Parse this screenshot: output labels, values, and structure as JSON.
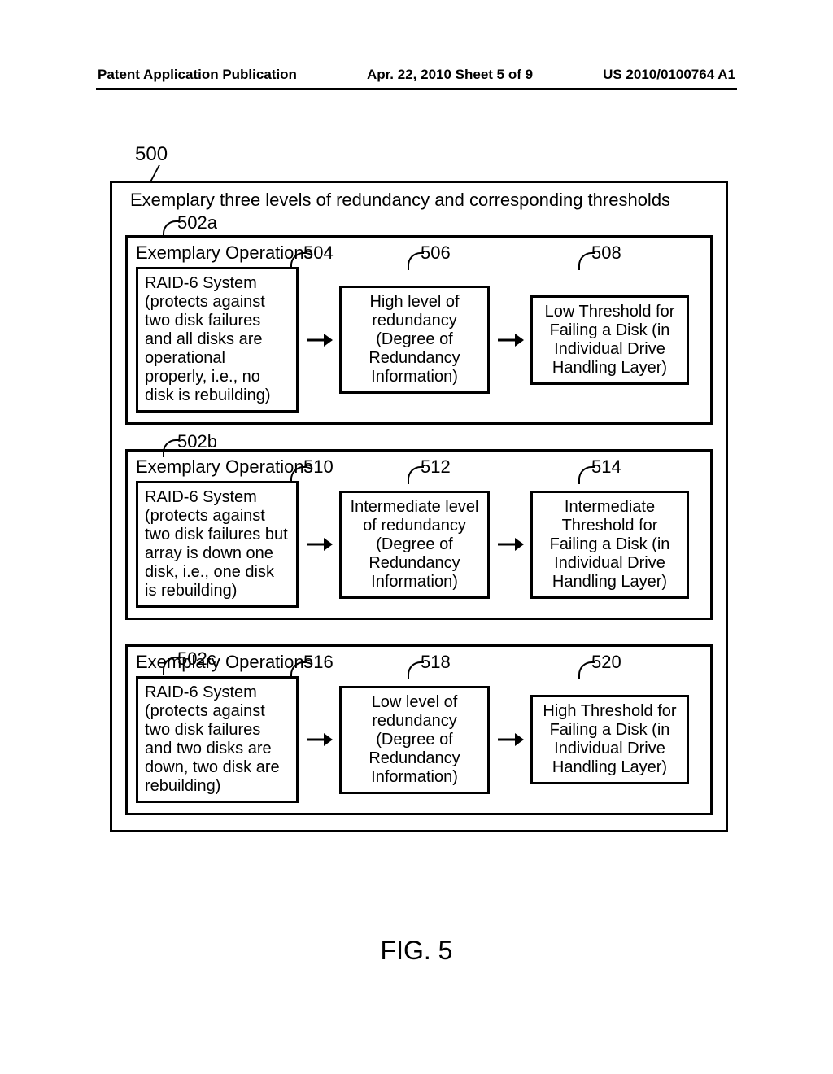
{
  "header": {
    "left": "Patent Application Publication",
    "center": "Apr. 22, 2010  Sheet 5 of 9",
    "right": "US 2010/0100764 A1"
  },
  "ref500": "500",
  "outerTitle": "Exemplary three levels of redundancy and corresponding thresholds",
  "groups": [
    {
      "groupRef": "502a",
      "opsTitle": "Exemplary Operations",
      "leftRef": "504",
      "midRef": "506",
      "rightRef": "508",
      "left": "RAID-6 System (protects against two disk failures and all disks are operational properly, i.e., no disk is rebuilding)",
      "mid": "High level of redundancy (Degree of Redundancy Information)",
      "right": "Low Threshold for Failing a Disk (in Individual Drive Handling Layer)"
    },
    {
      "groupRef": "502b",
      "opsTitle": "Exemplary Operations",
      "leftRef": "510",
      "midRef": "512",
      "rightRef": "514",
      "left": "RAID-6 System (protects against two disk failures but array is down one disk, i.e., one disk is rebuilding)",
      "mid": "Intermediate level of redundancy (Degree of Redundancy Information)",
      "right": "Intermediate Threshold for Failing a Disk (in Individual Drive Handling Layer)"
    },
    {
      "groupRef": "502c",
      "opsTitle": "Exemplary Operations",
      "leftRef": "516",
      "midRef": "518",
      "rightRef": "520",
      "left": "RAID-6 System (protects against two disk failures and two disks are down, two disk are rebuilding)",
      "mid": "Low level of redundancy (Degree of Redundancy Information)",
      "right": "High Threshold for Failing a Disk (in Individual Drive Handling Layer)"
    }
  ],
  "figCaption": "FIG. 5"
}
